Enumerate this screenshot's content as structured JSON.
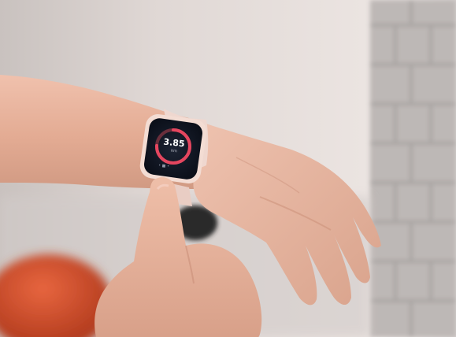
{
  "photo": {
    "watch_display": {
      "main_value": "3.85",
      "sub_label": "km",
      "footer": "• ■ •"
    },
    "colors": {
      "background_wall": "#e7dfdc",
      "brick_wall": "#b8b4b2",
      "skin": "#e7b39c",
      "watch_band": "#efd7cf",
      "watch_screen": "#101522",
      "ring_accent": "#e5465f",
      "ring_track": "#6a2e3b",
      "orange_object": "#d44a2f"
    }
  }
}
